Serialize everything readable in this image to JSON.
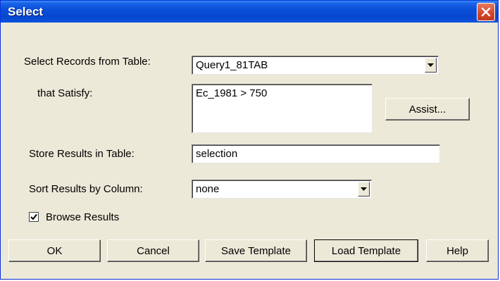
{
  "window": {
    "title": "Select"
  },
  "form": {
    "table_label": "Select Records from Table:",
    "table_value": "Query1_81TAB",
    "satisfy_label": "that Satisfy:",
    "satisfy_value": "Ec_1981 > 750",
    "assist_label": "Assist...",
    "store_label": "Store Results in Table:",
    "store_value": "selection",
    "sort_label": "Sort Results by Column:",
    "sort_value": "none",
    "browse_label": "Browse Results",
    "browse_checked": true
  },
  "buttons": {
    "ok": "OK",
    "cancel": "Cancel",
    "save_template": "Save Template",
    "load_template": "Load Template",
    "help": "Help"
  }
}
